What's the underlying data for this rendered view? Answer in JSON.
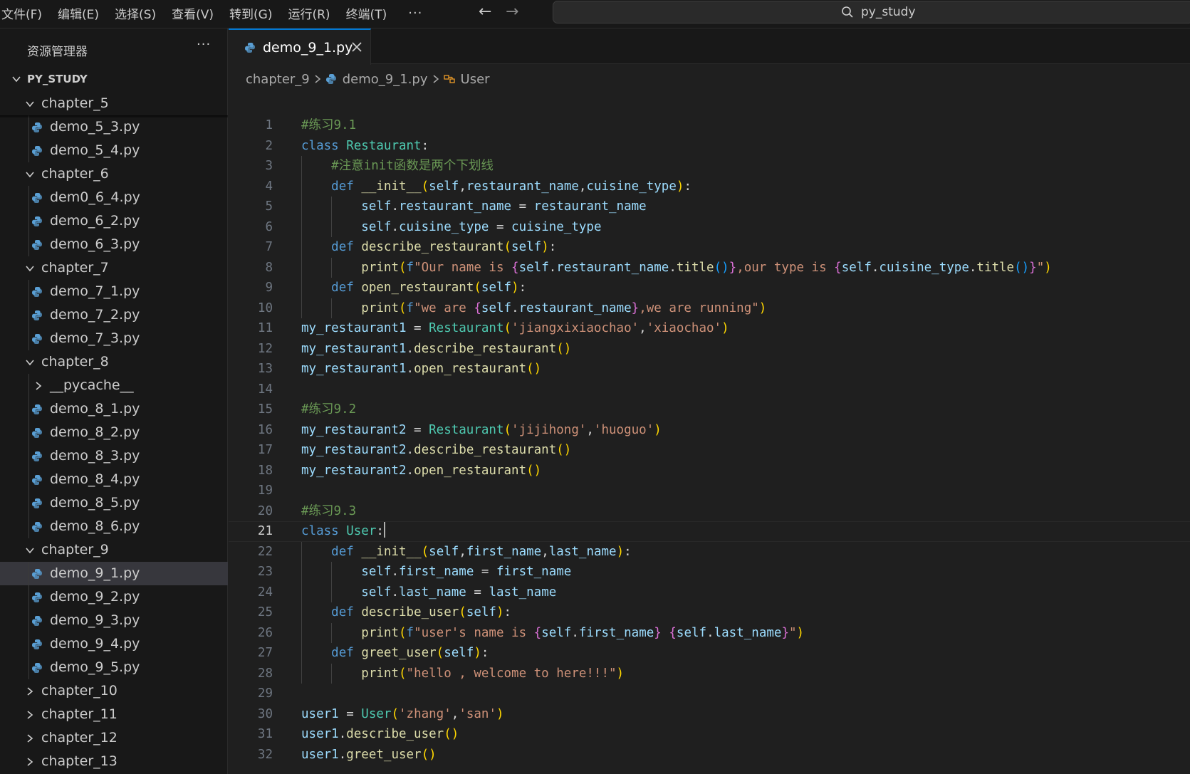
{
  "menu": [
    "文件(F)",
    "编辑(E)",
    "选择(S)",
    "查看(V)",
    "转到(G)",
    "运行(R)",
    "终端(T)"
  ],
  "menu_more": "···",
  "search": {
    "text": "py_study"
  },
  "sidebar": {
    "title": "资源管理器",
    "more": "···",
    "root": "PY_STUDY",
    "items": [
      {
        "type": "folder",
        "label": "chapter_5",
        "open": true,
        "level": 1
      },
      {
        "type": "file",
        "label": "demo_5_3.py",
        "level": 2
      },
      {
        "type": "file",
        "label": "demo_5_4.py",
        "level": 2
      },
      {
        "type": "folder",
        "label": "chapter_6",
        "open": true,
        "level": 1
      },
      {
        "type": "file",
        "label": "dem0_6_4.py",
        "level": 2
      },
      {
        "type": "file",
        "label": "demo_6_2.py",
        "level": 2
      },
      {
        "type": "file",
        "label": "demo_6_3.py",
        "level": 2
      },
      {
        "type": "folder",
        "label": "chapter_7",
        "open": true,
        "level": 1
      },
      {
        "type": "file",
        "label": "demo_7_1.py",
        "level": 2
      },
      {
        "type": "file",
        "label": "demo_7_2.py",
        "level": 2
      },
      {
        "type": "file",
        "label": "demo_7_3.py",
        "level": 2
      },
      {
        "type": "folder",
        "label": "chapter_8",
        "open": true,
        "level": 1
      },
      {
        "type": "folder",
        "label": "__pycache__",
        "open": false,
        "level": 2
      },
      {
        "type": "file",
        "label": "demo_8_1.py",
        "level": 2
      },
      {
        "type": "file",
        "label": "demo_8_2.py",
        "level": 2
      },
      {
        "type": "file",
        "label": "demo_8_3.py",
        "level": 2
      },
      {
        "type": "file",
        "label": "demo_8_4.py",
        "level": 2
      },
      {
        "type": "file",
        "label": "demo_8_5.py",
        "level": 2
      },
      {
        "type": "file",
        "label": "demo_8_6.py",
        "level": 2
      },
      {
        "type": "folder",
        "label": "chapter_9",
        "open": true,
        "level": 1
      },
      {
        "type": "file",
        "label": "demo_9_1.py",
        "level": 2,
        "selected": true
      },
      {
        "type": "file",
        "label": "demo_9_2.py",
        "level": 2
      },
      {
        "type": "file",
        "label": "demo_9_3.py",
        "level": 2
      },
      {
        "type": "file",
        "label": "demo_9_4.py",
        "level": 2
      },
      {
        "type": "file",
        "label": "demo_9_5.py",
        "level": 2
      },
      {
        "type": "folder",
        "label": "chapter_10",
        "open": false,
        "level": 1
      },
      {
        "type": "folder",
        "label": "chapter_11",
        "open": false,
        "level": 1
      },
      {
        "type": "folder",
        "label": "chapter_12",
        "open": false,
        "level": 1
      },
      {
        "type": "folder",
        "label": "chapter_13",
        "open": false,
        "level": 1
      }
    ]
  },
  "tab": {
    "label": "demo_9_1.py"
  },
  "breadcrumb": {
    "folder": "chapter_9",
    "file": "demo_9_1.py",
    "symbol": "User"
  },
  "editor": {
    "current_line": 21,
    "lines": [
      [
        {
          "t": "#练习9.1",
          "c": "cmt"
        }
      ],
      [
        {
          "t": "class",
          "c": "kw"
        },
        {
          "t": " "
        },
        {
          "t": "Restaurant",
          "c": "cls"
        },
        {
          "t": ":",
          "c": "op"
        }
      ],
      [
        {
          "t": "    "
        },
        {
          "t": "#注意init函数是两个下划线",
          "c": "cmt"
        }
      ],
      [
        {
          "t": "    "
        },
        {
          "t": "def",
          "c": "kw"
        },
        {
          "t": " "
        },
        {
          "t": "__init__",
          "c": "fn"
        },
        {
          "t": "(",
          "c": "b1"
        },
        {
          "t": "self",
          "c": "var"
        },
        {
          "t": ",",
          "c": "op"
        },
        {
          "t": "restaurant_name",
          "c": "var"
        },
        {
          "t": ",",
          "c": "op"
        },
        {
          "t": "cuisine_type",
          "c": "var"
        },
        {
          "t": ")",
          "c": "b1"
        },
        {
          "t": ":",
          "c": "op"
        }
      ],
      [
        {
          "t": "        "
        },
        {
          "t": "self",
          "c": "var"
        },
        {
          "t": ".",
          "c": "op"
        },
        {
          "t": "restaurant_name",
          "c": "var"
        },
        {
          "t": " = ",
          "c": "op"
        },
        {
          "t": "restaurant_name",
          "c": "var"
        }
      ],
      [
        {
          "t": "        "
        },
        {
          "t": "self",
          "c": "var"
        },
        {
          "t": ".",
          "c": "op"
        },
        {
          "t": "cuisine_type",
          "c": "var"
        },
        {
          "t": " = ",
          "c": "op"
        },
        {
          "t": "cuisine_type",
          "c": "var"
        }
      ],
      [
        {
          "t": "    "
        },
        {
          "t": "def",
          "c": "kw"
        },
        {
          "t": " "
        },
        {
          "t": "describe_restaurant",
          "c": "fn"
        },
        {
          "t": "(",
          "c": "b1"
        },
        {
          "t": "self",
          "c": "var"
        },
        {
          "t": ")",
          "c": "b1"
        },
        {
          "t": ":",
          "c": "op"
        }
      ],
      [
        {
          "t": "        "
        },
        {
          "t": "print",
          "c": "fn"
        },
        {
          "t": "(",
          "c": "b1"
        },
        {
          "t": "f",
          "c": "kw"
        },
        {
          "t": "\"Our name is ",
          "c": "str"
        },
        {
          "t": "{",
          "c": "b2"
        },
        {
          "t": "self",
          "c": "var"
        },
        {
          "t": ".",
          "c": "op"
        },
        {
          "t": "restaurant_name",
          "c": "var"
        },
        {
          "t": ".",
          "c": "op"
        },
        {
          "t": "title",
          "c": "fn"
        },
        {
          "t": "()",
          "c": "b3"
        },
        {
          "t": "}",
          "c": "b2"
        },
        {
          "t": ",our type is ",
          "c": "str"
        },
        {
          "t": "{",
          "c": "b2"
        },
        {
          "t": "self",
          "c": "var"
        },
        {
          "t": ".",
          "c": "op"
        },
        {
          "t": "cuisine_type",
          "c": "var"
        },
        {
          "t": ".",
          "c": "op"
        },
        {
          "t": "title",
          "c": "fn"
        },
        {
          "t": "()",
          "c": "b3"
        },
        {
          "t": "}",
          "c": "b2"
        },
        {
          "t": "\"",
          "c": "str"
        },
        {
          "t": ")",
          "c": "b1"
        }
      ],
      [
        {
          "t": "    "
        },
        {
          "t": "def",
          "c": "kw"
        },
        {
          "t": " "
        },
        {
          "t": "open_restaurant",
          "c": "fn"
        },
        {
          "t": "(",
          "c": "b1"
        },
        {
          "t": "self",
          "c": "var"
        },
        {
          "t": ")",
          "c": "b1"
        },
        {
          "t": ":",
          "c": "op"
        }
      ],
      [
        {
          "t": "        "
        },
        {
          "t": "print",
          "c": "fn"
        },
        {
          "t": "(",
          "c": "b1"
        },
        {
          "t": "f",
          "c": "kw"
        },
        {
          "t": "\"we are ",
          "c": "str"
        },
        {
          "t": "{",
          "c": "b2"
        },
        {
          "t": "self",
          "c": "var"
        },
        {
          "t": ".",
          "c": "op"
        },
        {
          "t": "restaurant_name",
          "c": "var"
        },
        {
          "t": "}",
          "c": "b2"
        },
        {
          "t": ",we are running\"",
          "c": "str"
        },
        {
          "t": ")",
          "c": "b1"
        }
      ],
      [
        {
          "t": "my_restaurant1",
          "c": "var"
        },
        {
          "t": " = ",
          "c": "op"
        },
        {
          "t": "Restaurant",
          "c": "cls"
        },
        {
          "t": "(",
          "c": "b1"
        },
        {
          "t": "'jiangxixiaochao'",
          "c": "str"
        },
        {
          "t": ",",
          "c": "op"
        },
        {
          "t": "'xiaochao'",
          "c": "str"
        },
        {
          "t": ")",
          "c": "b1"
        }
      ],
      [
        {
          "t": "my_restaurant1",
          "c": "var"
        },
        {
          "t": ".",
          "c": "op"
        },
        {
          "t": "describe_restaurant",
          "c": "fn"
        },
        {
          "t": "()",
          "c": "b1"
        }
      ],
      [
        {
          "t": "my_restaurant1",
          "c": "var"
        },
        {
          "t": ".",
          "c": "op"
        },
        {
          "t": "open_restaurant",
          "c": "fn"
        },
        {
          "t": "()",
          "c": "b1"
        }
      ],
      [],
      [
        {
          "t": "#练习9.2",
          "c": "cmt"
        }
      ],
      [
        {
          "t": "my_restaurant2",
          "c": "var"
        },
        {
          "t": " = ",
          "c": "op"
        },
        {
          "t": "Restaurant",
          "c": "cls"
        },
        {
          "t": "(",
          "c": "b1"
        },
        {
          "t": "'jijihong'",
          "c": "str"
        },
        {
          "t": ",",
          "c": "op"
        },
        {
          "t": "'huoguo'",
          "c": "str"
        },
        {
          "t": ")",
          "c": "b1"
        }
      ],
      [
        {
          "t": "my_restaurant2",
          "c": "var"
        },
        {
          "t": ".",
          "c": "op"
        },
        {
          "t": "describe_restaurant",
          "c": "fn"
        },
        {
          "t": "()",
          "c": "b1"
        }
      ],
      [
        {
          "t": "my_restaurant2",
          "c": "var"
        },
        {
          "t": ".",
          "c": "op"
        },
        {
          "t": "open_restaurant",
          "c": "fn"
        },
        {
          "t": "()",
          "c": "b1"
        }
      ],
      [],
      [
        {
          "t": "#练习9.3",
          "c": "cmt"
        }
      ],
      [
        {
          "t": "class",
          "c": "kw"
        },
        {
          "t": " "
        },
        {
          "t": "User",
          "c": "cls"
        },
        {
          "t": ":",
          "c": "op"
        }
      ],
      [
        {
          "t": "    "
        },
        {
          "t": "def",
          "c": "kw"
        },
        {
          "t": " "
        },
        {
          "t": "__init__",
          "c": "fn"
        },
        {
          "t": "(",
          "c": "b1"
        },
        {
          "t": "self",
          "c": "var"
        },
        {
          "t": ",",
          "c": "op"
        },
        {
          "t": "first_name",
          "c": "var"
        },
        {
          "t": ",",
          "c": "op"
        },
        {
          "t": "last_name",
          "c": "var"
        },
        {
          "t": ")",
          "c": "b1"
        },
        {
          "t": ":",
          "c": "op"
        }
      ],
      [
        {
          "t": "        "
        },
        {
          "t": "self",
          "c": "var"
        },
        {
          "t": ".",
          "c": "op"
        },
        {
          "t": "first_name",
          "c": "var"
        },
        {
          "t": " = ",
          "c": "op"
        },
        {
          "t": "first_name",
          "c": "var"
        }
      ],
      [
        {
          "t": "        "
        },
        {
          "t": "self",
          "c": "var"
        },
        {
          "t": ".",
          "c": "op"
        },
        {
          "t": "last_name",
          "c": "var"
        },
        {
          "t": " = ",
          "c": "op"
        },
        {
          "t": "last_name",
          "c": "var"
        }
      ],
      [
        {
          "t": "    "
        },
        {
          "t": "def",
          "c": "kw"
        },
        {
          "t": " "
        },
        {
          "t": "describe_user",
          "c": "fn"
        },
        {
          "t": "(",
          "c": "b1"
        },
        {
          "t": "self",
          "c": "var"
        },
        {
          "t": ")",
          "c": "b1"
        },
        {
          "t": ":",
          "c": "op"
        }
      ],
      [
        {
          "t": "        "
        },
        {
          "t": "print",
          "c": "fn"
        },
        {
          "t": "(",
          "c": "b1"
        },
        {
          "t": "f",
          "c": "kw"
        },
        {
          "t": "\"user's name is ",
          "c": "str"
        },
        {
          "t": "{",
          "c": "b2"
        },
        {
          "t": "self",
          "c": "var"
        },
        {
          "t": ".",
          "c": "op"
        },
        {
          "t": "first_name",
          "c": "var"
        },
        {
          "t": "}",
          "c": "b2"
        },
        {
          "t": " ",
          "c": "str"
        },
        {
          "t": "{",
          "c": "b2"
        },
        {
          "t": "self",
          "c": "var"
        },
        {
          "t": ".",
          "c": "op"
        },
        {
          "t": "last_name",
          "c": "var"
        },
        {
          "t": "}",
          "c": "b2"
        },
        {
          "t": "\"",
          "c": "str"
        },
        {
          "t": ")",
          "c": "b1"
        }
      ],
      [
        {
          "t": "    "
        },
        {
          "t": "def",
          "c": "kw"
        },
        {
          "t": " "
        },
        {
          "t": "greet_user",
          "c": "fn"
        },
        {
          "t": "(",
          "c": "b1"
        },
        {
          "t": "self",
          "c": "var"
        },
        {
          "t": ")",
          "c": "b1"
        },
        {
          "t": ":",
          "c": "op"
        }
      ],
      [
        {
          "t": "        "
        },
        {
          "t": "print",
          "c": "fn"
        },
        {
          "t": "(",
          "c": "b1"
        },
        {
          "t": "\"hello , welcome to here!!!\"",
          "c": "str"
        },
        {
          "t": ")",
          "c": "b1"
        }
      ],
      [],
      [
        {
          "t": "user1",
          "c": "var"
        },
        {
          "t": " = ",
          "c": "op"
        },
        {
          "t": "User",
          "c": "cls"
        },
        {
          "t": "(",
          "c": "b1"
        },
        {
          "t": "'zhang'",
          "c": "str"
        },
        {
          "t": ",",
          "c": "op"
        },
        {
          "t": "'san'",
          "c": "str"
        },
        {
          "t": ")",
          "c": "b1"
        }
      ],
      [
        {
          "t": "user1",
          "c": "var"
        },
        {
          "t": ".",
          "c": "op"
        },
        {
          "t": "describe_user",
          "c": "fn"
        },
        {
          "t": "()",
          "c": "b1"
        }
      ],
      [
        {
          "t": "user1",
          "c": "var"
        },
        {
          "t": ".",
          "c": "op"
        },
        {
          "t": "greet_user",
          "c": "fn"
        },
        {
          "t": "()",
          "c": "b1"
        }
      ]
    ]
  }
}
